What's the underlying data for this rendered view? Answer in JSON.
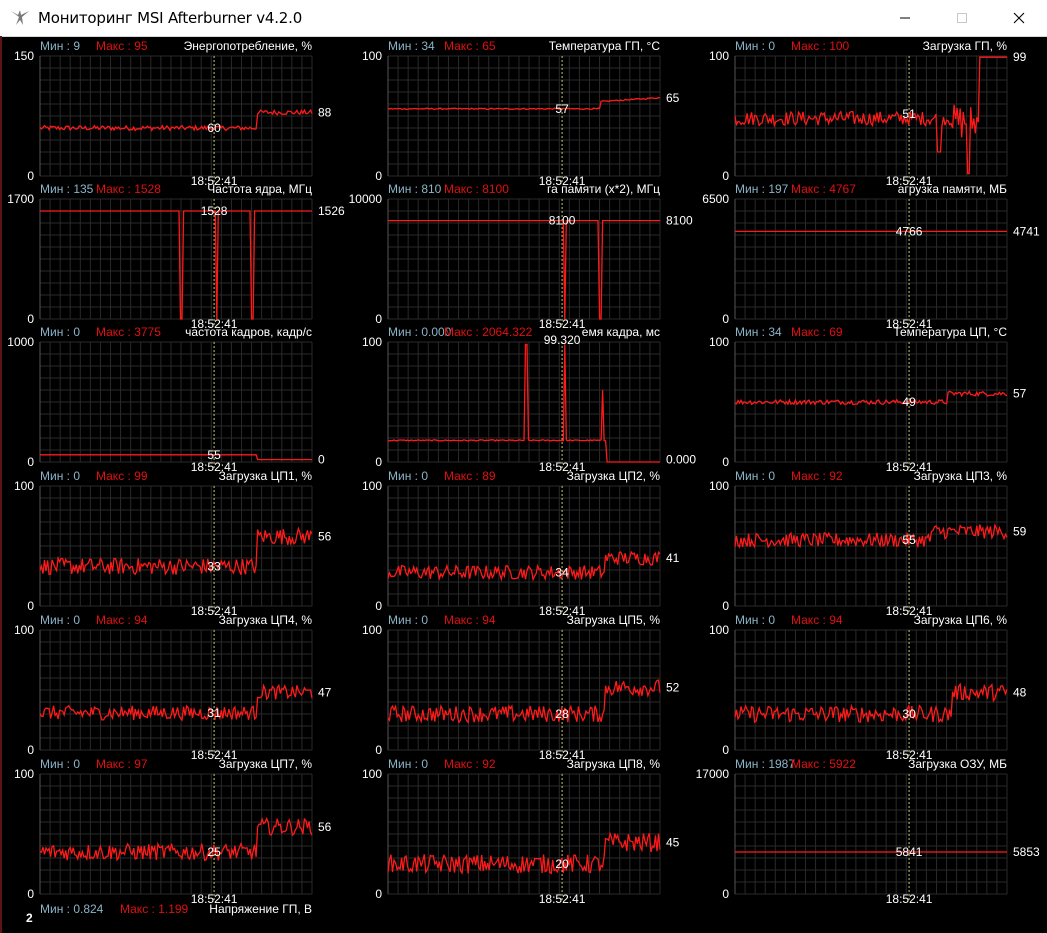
{
  "window": {
    "title": "Мониторинг MSI Afterburner v4.2.0"
  },
  "labels": {
    "min": "Мин",
    "max": "Макс"
  },
  "colors": {
    "line": "#ff1a1a",
    "max_text": "#e01010",
    "min_text": "#8ab4c8",
    "grid": "#2a2a2a",
    "cursor": "#c8c86a",
    "text": "#ffffff"
  },
  "graphs": [
    {
      "id": "power",
      "title": "Энергопотребление, %",
      "min": "9",
      "max": "95",
      "ymax": "150",
      "ymin": "0",
      "cursor_time": "18:52:41",
      "cursor_value": "60",
      "current": "88"
    },
    {
      "id": "gpu-temp",
      "title": "Температура ГП, °C",
      "min": "34",
      "max": "65",
      "ymax": "100",
      "ymin": "0",
      "cursor_time": "18:52:41",
      "cursor_value": "57",
      "current": "65"
    },
    {
      "id": "gpu-load",
      "title": "Загрузка ГП, %",
      "min": "0",
      "max": "100",
      "ymax": "100",
      "ymin": "0",
      "cursor_time": "18:52:41",
      "cursor_value": "51",
      "current": "99"
    },
    {
      "id": "core-clock",
      "title": "Частота ядра, МГц",
      "min": "135",
      "max": "1528",
      "ymax": "1700",
      "ymin": "0",
      "cursor_time": "18:52:41",
      "cursor_value": "1528",
      "current": "1526"
    },
    {
      "id": "mem-clock",
      "title": "га памяти (x*2), МГц",
      "min": "810",
      "max": "8100",
      "ymax": "10000",
      "ymin": "0",
      "cursor_time": "18:52:41",
      "cursor_value": "8100",
      "current": "8100"
    },
    {
      "id": "mem-load",
      "title": "агрузка памяти, МБ",
      "min": "197",
      "max": "4767",
      "ymax": "6500",
      "ymin": "0",
      "cursor_time": "18:52:41",
      "cursor_value": "4766",
      "current": "4741"
    },
    {
      "id": "framerate",
      "title": "частота кадров, кадр/с",
      "min": "0",
      "max": "3775",
      "ymax": "1000",
      "ymin": "0",
      "cursor_time": "18:52:41",
      "cursor_value": "55",
      "current": "0"
    },
    {
      "id": "frametime",
      "title": "емя кадра, мс",
      "min": "0.000",
      "max": "2064.322",
      "ymax": "100",
      "ymin": "0",
      "cursor_time": "18:52:41",
      "cursor_value": "99.320",
      "current": "0.000"
    },
    {
      "id": "cpu-temp",
      "title": "Температура ЦП, °C",
      "min": "34",
      "max": "69",
      "ymax": "100",
      "ymin": "0",
      "cursor_time": "18:52:41",
      "cursor_value": "49",
      "current": "57"
    },
    {
      "id": "cpu1-load",
      "title": "Загрузка ЦП1, %",
      "min": "0",
      "max": "99",
      "ymax": "100",
      "ymin": "0",
      "cursor_time": "18:52:41",
      "cursor_value": "33",
      "current": "56"
    },
    {
      "id": "cpu2-load",
      "title": "Загрузка ЦП2, %",
      "min": "0",
      "max": "89",
      "ymax": "100",
      "ymin": "0",
      "cursor_time": "18:52:41",
      "cursor_value": "34",
      "current": "41"
    },
    {
      "id": "cpu3-load",
      "title": "Загрузка ЦП3, %",
      "min": "0",
      "max": "92",
      "ymax": "100",
      "ymin": "0",
      "cursor_time": "18:52:41",
      "cursor_value": "55",
      "current": "59"
    },
    {
      "id": "cpu4-load",
      "title": "Загрузка ЦП4, %",
      "min": "0",
      "max": "94",
      "ymax": "100",
      "ymin": "0",
      "cursor_time": "18:52:41",
      "cursor_value": "31",
      "current": "47"
    },
    {
      "id": "cpu5-load",
      "title": "Загрузка ЦП5, %",
      "min": "0",
      "max": "94",
      "ymax": "100",
      "ymin": "0",
      "cursor_time": "18:52:41",
      "cursor_value": "28",
      "current": "52"
    },
    {
      "id": "cpu6-load",
      "title": "Загрузка ЦП6, %",
      "min": "0",
      "max": "94",
      "ymax": "100",
      "ymin": "0",
      "cursor_time": "18:52:41",
      "cursor_value": "30",
      "current": "48"
    },
    {
      "id": "cpu7-load",
      "title": "Загрузка ЦП7, %",
      "min": "0",
      "max": "97",
      "ymax": "100",
      "ymin": "0",
      "cursor_time": "18:52:41",
      "cursor_value": "25",
      "current": "56"
    },
    {
      "id": "cpu8-load",
      "title": "Загрузка ЦП8, %",
      "min": "0",
      "max": "92",
      "ymax": "100",
      "ymin": "0",
      "cursor_time": "18:52:41",
      "cursor_value": "20",
      "current": "45"
    },
    {
      "id": "ram-usage",
      "title": "Загрузка ОЗУ, МБ",
      "min": "1987",
      "max": "5922",
      "ymax": "17000",
      "ymin": "0",
      "cursor_time": "18:52:41",
      "cursor_value": "5841",
      "current": "5853"
    },
    {
      "id": "gpu-voltage",
      "title": "Напряжение ГП, В",
      "min": "0.824",
      "max": "1.199",
      "ymax": "2"
    }
  ]
}
